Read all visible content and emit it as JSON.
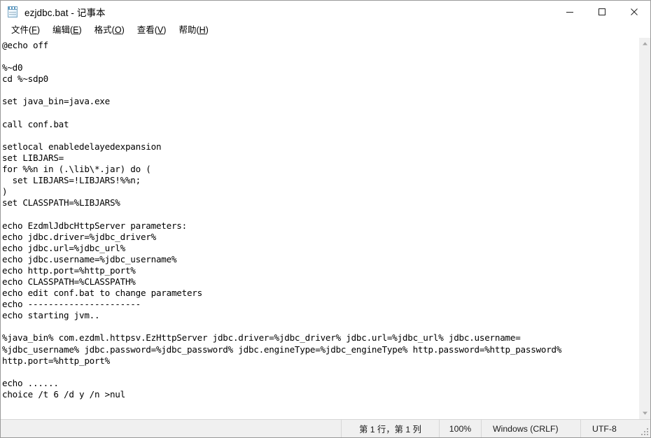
{
  "window": {
    "title": "ezjdbc.bat - 记事本",
    "icon": "notepad-icon",
    "controls": {
      "minimize": "minimize-icon",
      "maximize": "maximize-icon",
      "close": "close-icon"
    }
  },
  "menubar": {
    "items": [
      {
        "label": "文件(F)",
        "text": "文件(",
        "accel": "F",
        "tail": ")"
      },
      {
        "label": "编辑(E)",
        "text": "编辑(",
        "accel": "E",
        "tail": ")"
      },
      {
        "label": "格式(O)",
        "text": "格式(",
        "accel": "O",
        "tail": ")"
      },
      {
        "label": "查看(V)",
        "text": "查看(",
        "accel": "V",
        "tail": ")"
      },
      {
        "label": "帮助(H)",
        "text": "帮助(",
        "accel": "H",
        "tail": ")"
      }
    ]
  },
  "editor": {
    "content": "@echo off\n\n%~d0\ncd %~sdp0\n\nset java_bin=java.exe\n\ncall conf.bat\n\nsetlocal enabledelayedexpansion\nset LIBJARS=\nfor %%n in (.\\lib\\*.jar) do (\n  set LIBJARS=!LIBJARS!%%n;\n)\nset CLASSPATH=%LIBJARS%\n\necho EzdmlJdbcHttpServer parameters:\necho jdbc.driver=%jdbc_driver%\necho jdbc.url=%jdbc_url%\necho jdbc.username=%jdbc_username%\necho http.port=%http_port%\necho CLASSPATH=%CLASSPATH%\necho edit conf.bat to change parameters\necho ----------------------\necho starting jvm..\n\n%java_bin% com.ezdml.httpsv.EzHttpServer jdbc.driver=%jdbc_driver% jdbc.url=%jdbc_url% jdbc.username=\n%jdbc_username% jdbc.password=%jdbc_password% jdbc.engineType=%jdbc_engineType% http.password=%http_password%\nhttp.port=%http_port%\n\necho ......\nchoice /t 6 /d y /n >nul"
  },
  "scrollbar": {
    "up_arrow": "scroll-up-icon",
    "down_arrow": "scroll-down-icon"
  },
  "statusbar": {
    "position": "第 1 行，第 1 列",
    "zoom": "100%",
    "line_ending": "Windows (CRLF)",
    "encoding": "UTF-8"
  }
}
